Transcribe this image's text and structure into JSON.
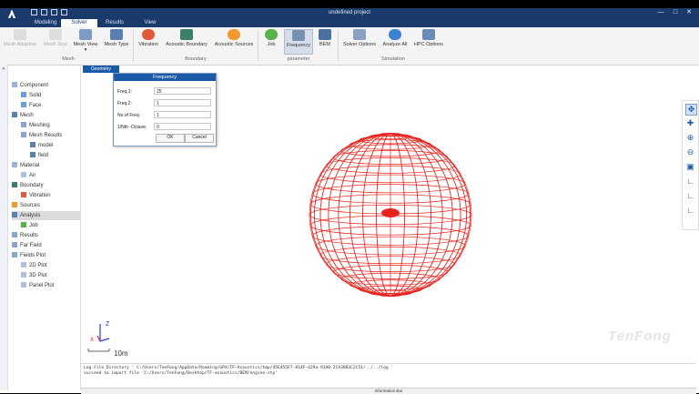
{
  "window": {
    "title": "undefined project"
  },
  "tabs": [
    {
      "label": "Modeling"
    },
    {
      "label": "Solver"
    },
    {
      "label": "Results"
    },
    {
      "label": "View"
    }
  ],
  "ribbon": {
    "buttons": [
      {
        "label": "Mesh Adaptive"
      },
      {
        "label": "Mesh Size"
      },
      {
        "label": "Mesh View"
      },
      {
        "label": "Mesh Type"
      },
      {
        "label": "Vibration"
      },
      {
        "label": "Acoustic Boundary"
      },
      {
        "label": "Acoustic Sources"
      },
      {
        "label": "Job"
      },
      {
        "label": "Frequency"
      },
      {
        "label": "BEM"
      },
      {
        "label": "Solver Options"
      },
      {
        "label": "Analyze All"
      },
      {
        "label": "HPC Options"
      }
    ],
    "groups": [
      {
        "label": "Mesh"
      },
      {
        "label": "Boundary"
      },
      {
        "label": "parameter"
      },
      {
        "label": "Simulation"
      }
    ]
  },
  "tree": {
    "items": [
      {
        "label": "Component"
      },
      {
        "label": "Solid"
      },
      {
        "label": "Face"
      },
      {
        "label": "Mesh"
      },
      {
        "label": "Meshing"
      },
      {
        "label": "Mesh Results"
      },
      {
        "label": "model"
      },
      {
        "label": "field"
      },
      {
        "label": "Material"
      },
      {
        "label": "Air"
      },
      {
        "label": "Boundary"
      },
      {
        "label": "Vibration"
      },
      {
        "label": "Sources"
      },
      {
        "label": "Analysis"
      },
      {
        "label": "Job"
      },
      {
        "label": "Results"
      },
      {
        "label": "Far Field"
      },
      {
        "label": "Fields Plot"
      },
      {
        "label": "2D Plot"
      },
      {
        "label": "3D Plot"
      },
      {
        "label": "Panel Plot"
      }
    ]
  },
  "viewport": {
    "tab_label": "Geometry",
    "axis_z": "Z",
    "axis_x": "X",
    "scale_label": "10m",
    "brand": "TenFong"
  },
  "dialog": {
    "title": "Frequency",
    "fields": [
      {
        "label": "Freq.1:",
        "value": "25"
      },
      {
        "label": "Freq.2:",
        "value": "1"
      },
      {
        "label": "No.of Freq:",
        "value": "1"
      },
      {
        "label": "1/Nth -Octave:",
        "value": "0"
      }
    ],
    "ok_label": "OK",
    "cancel_label": "Cancel"
  },
  "log": {
    "line1": "Log File Directory ' C:/Users/TenFong/AppData/Roaming/GPX/TF-Acoustics/tmp/45E455F7-814F-429a-91A0-2CA3883C2C51/../../log '",
    "line2": "succeed to import file 'C:/Users/TenFong/Desktop/TF-acoustics/BEM/engine.stp'"
  },
  "info_bar": {
    "label": "Information Bar"
  },
  "colors": {
    "title_bar": "#1a3a6b",
    "accent": "#1a5aa8",
    "mesh": "#e8221c"
  }
}
